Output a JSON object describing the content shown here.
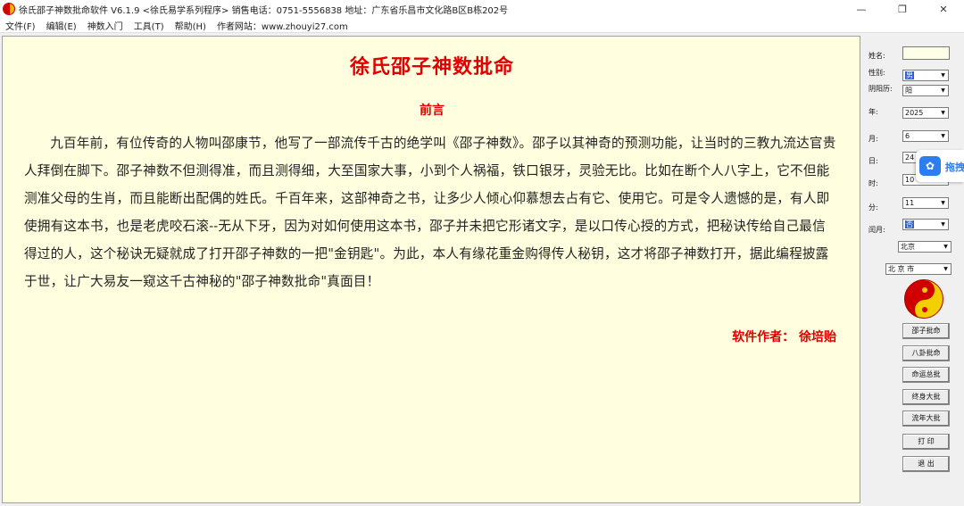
{
  "window": {
    "title": "徐氏邵子神数批命软件 V6.1.9 <徐氏易学系列程序>    销售电话：0751-5556838    地址：广东省乐昌市文化路B区B栋202号",
    "minimize": "—",
    "restore": "❐",
    "close": "✕"
  },
  "menu": [
    "文件(F)",
    "编辑(E)",
    "神数入门",
    "工具(T)",
    "帮助(H)",
    "作者网站：www.zhouyi27.com"
  ],
  "content": {
    "title": "徐氏邵子神数批命",
    "subtitle": "前言",
    "body": "九百年前，有位传奇的人物叫邵康节，他写了一部流传千古的绝学叫《邵子神数》。邵子以其神奇的预测功能，让当时的三教九流达官贵人拜倒在脚下。邵子神数不但测得准，而且测得细，大至国家大事，小到个人祸福，铁口银牙，灵验无比。比如在断个人八字上，它不但能测准父母的生肖，而且能断出配偶的姓氏。千百年来，这部神奇之书，让多少人倾心仰慕想去占有它、使用它。可是令人遗憾的是，有人即使拥有这本书，也是老虎咬石滚--无从下牙，因为对如何使用这本书，邵子并未把它形诸文字，是以口传心授的方式，把秘诀传给自己最信得过的人，这个秘诀无疑就成了打开邵子神数的一把\"金钥匙\"。为此，本人有缘花重金购得传人秘钥，这才将邵子神数打开，据此编程披露于世，让广大易友一窥这千古神秘的\"邵子神数批命\"真面目！",
    "author": "软件作者：  徐培贻"
  },
  "panel": {
    "name_label": "姓名:",
    "name_value": "",
    "gender_label": "性别:",
    "gender_value": "男",
    "calendar_label": "阴阳历:",
    "calendar_value": "阳",
    "year_label": "年:",
    "year_value": "2025",
    "month_label": "月:",
    "month_value": "6",
    "day_label": "日:",
    "day_value": "24",
    "hour_label": "时:",
    "hour_value": "10",
    "minute_label": "分:",
    "minute_value": "11",
    "leap_label": "闰月:",
    "leap_value": "否",
    "province_value": "北京",
    "city_value": "北 京 市",
    "buttons": [
      "邵子批命",
      "八卦批命",
      "命运总批",
      "终身大批",
      "流年大批",
      "打  印",
      "退  出"
    ]
  },
  "float_widget": {
    "label": "拖拽"
  },
  "colors": {
    "title_red": "#e00000",
    "paper": "#ffffe0",
    "accent_blue": "#2b7df0"
  }
}
